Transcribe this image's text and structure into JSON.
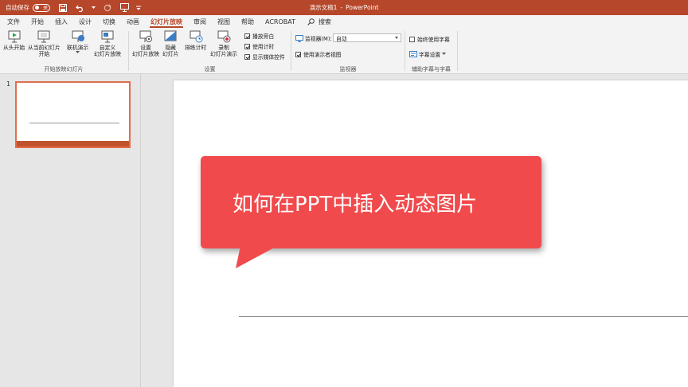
{
  "titlebar": {
    "autosave_label": "自动保存",
    "autosave_state": "关",
    "document_title": "演示文稿1",
    "separator": "-",
    "app_name": "PowerPoint"
  },
  "tabs": [
    {
      "label": "文件"
    },
    {
      "label": "开始"
    },
    {
      "label": "插入"
    },
    {
      "label": "设计"
    },
    {
      "label": "切换"
    },
    {
      "label": "动画"
    },
    {
      "label": "幻灯片放映"
    },
    {
      "label": "审阅"
    },
    {
      "label": "视图"
    },
    {
      "label": "帮助"
    },
    {
      "label": "ACROBAT"
    }
  ],
  "active_tab": "幻灯片放映",
  "search": {
    "label": "搜索"
  },
  "ribbon": {
    "start_group": {
      "from_beginning": "从头开始",
      "from_current_l1": "从当前幻灯片",
      "from_current_l2": "开始",
      "label": "开始放映幻灯片"
    },
    "present_online_l1": "联机演示",
    "custom_show_l1": "自定义",
    "custom_show_l2": "幻灯片放映",
    "setup_group": {
      "setup_show_l1": "设置",
      "setup_show_l2": "幻灯片放映",
      "hide_slide_l1": "隐藏",
      "hide_slide_l2": "幻灯片",
      "rehearse": "排练计时",
      "record_l1": "录制",
      "record_l2": "幻灯片演示",
      "play_narrations": "播放旁白",
      "use_timings": "使用计时",
      "show_media_controls": "显示媒体控件",
      "label": "设置"
    },
    "monitors_group": {
      "monitor_label": "监视器(M):",
      "monitor_value": "自动",
      "presenter_view": "使用演示者视图",
      "label": "监视器"
    },
    "captions_group": {
      "always_subtitles": "始终使用字幕",
      "subtitle_settings": "字幕设置",
      "label": "辅助字幕与字幕"
    }
  },
  "slides_pane": {
    "slide_number": "1"
  },
  "slide": {
    "callout_text": "如何在PPT中插入动态图片"
  },
  "colors": {
    "brand": "#b7472a",
    "callout": "#f04a4c",
    "thumb_border": "#e26d4c"
  }
}
